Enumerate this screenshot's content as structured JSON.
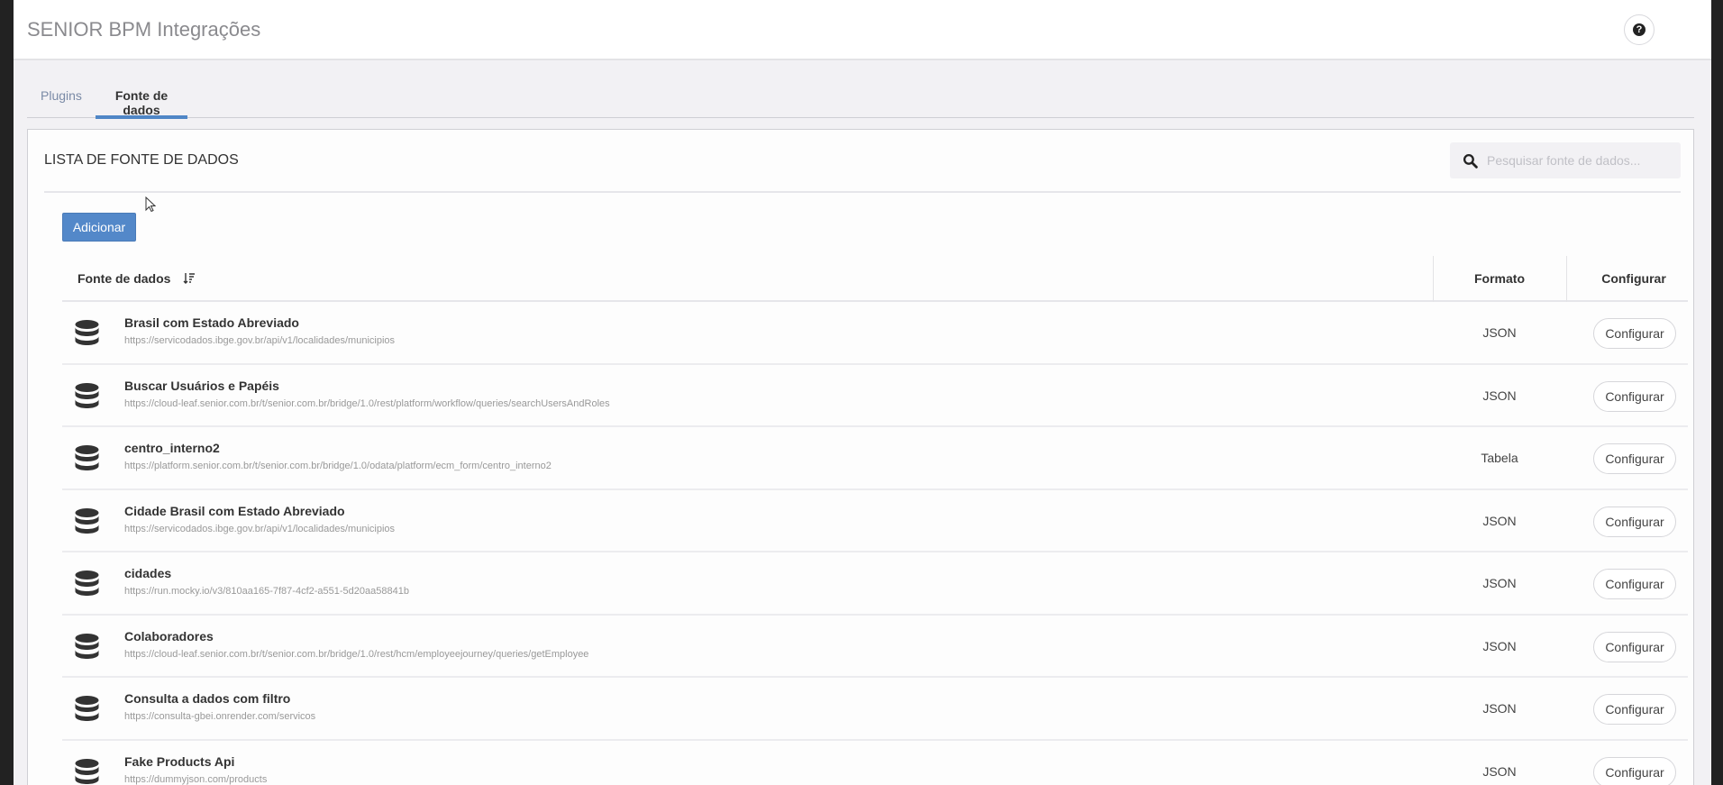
{
  "header": {
    "title": "SENIOR BPM Integrações",
    "help_icon": "question-circle-icon"
  },
  "tabs": [
    {
      "label": "Plugins",
      "active": false
    },
    {
      "label": "Fonte de dados",
      "active": true
    }
  ],
  "panel": {
    "title": "LISTA DE FONTE DE DADOS",
    "search_placeholder": "Pesquisar fonte de dados...",
    "add_label": "Adicionar",
    "accent": "#5388c9"
  },
  "table": {
    "columns": {
      "name": "Fonte de dados",
      "format": "Formato",
      "configure": "Configurar"
    },
    "rows": [
      {
        "name": "Brasil com Estado Abreviado",
        "url": "https://servicodados.ibge.gov.br/api/v1/localidades/municipios",
        "format": "JSON",
        "action": "Configurar"
      },
      {
        "name": "Buscar Usuários e Papéis",
        "url": "https://cloud-leaf.senior.com.br/t/senior.com.br/bridge/1.0/rest/platform/workflow/queries/searchUsersAndRoles",
        "format": "JSON",
        "action": "Configurar"
      },
      {
        "name": "centro_interno2",
        "url": "https://platform.senior.com.br/t/senior.com.br/bridge/1.0/odata/platform/ecm_form/centro_interno2",
        "format": "Tabela",
        "action": "Configurar"
      },
      {
        "name": "Cidade Brasil com Estado Abreviado",
        "url": "https://servicodados.ibge.gov.br/api/v1/localidades/municipios",
        "format": "JSON",
        "action": "Configurar"
      },
      {
        "name": "cidades",
        "url": "https://run.mocky.io/v3/810aa165-7f87-4cf2-a551-5d20aa58841b",
        "format": "JSON",
        "action": "Configurar"
      },
      {
        "name": "Colaboradores",
        "url": "https://cloud-leaf.senior.com.br/t/senior.com.br/bridge/1.0/rest/hcm/employeejourney/queries/getEmployee",
        "format": "JSON",
        "action": "Configurar"
      },
      {
        "name": "Consulta a dados com filtro",
        "url": "https://consulta-gbei.onrender.com/servicos",
        "format": "JSON",
        "action": "Configurar"
      },
      {
        "name": "Fake Products Api",
        "url": "https://dummyjson.com/products",
        "format": "JSON",
        "action": "Configurar"
      }
    ]
  }
}
